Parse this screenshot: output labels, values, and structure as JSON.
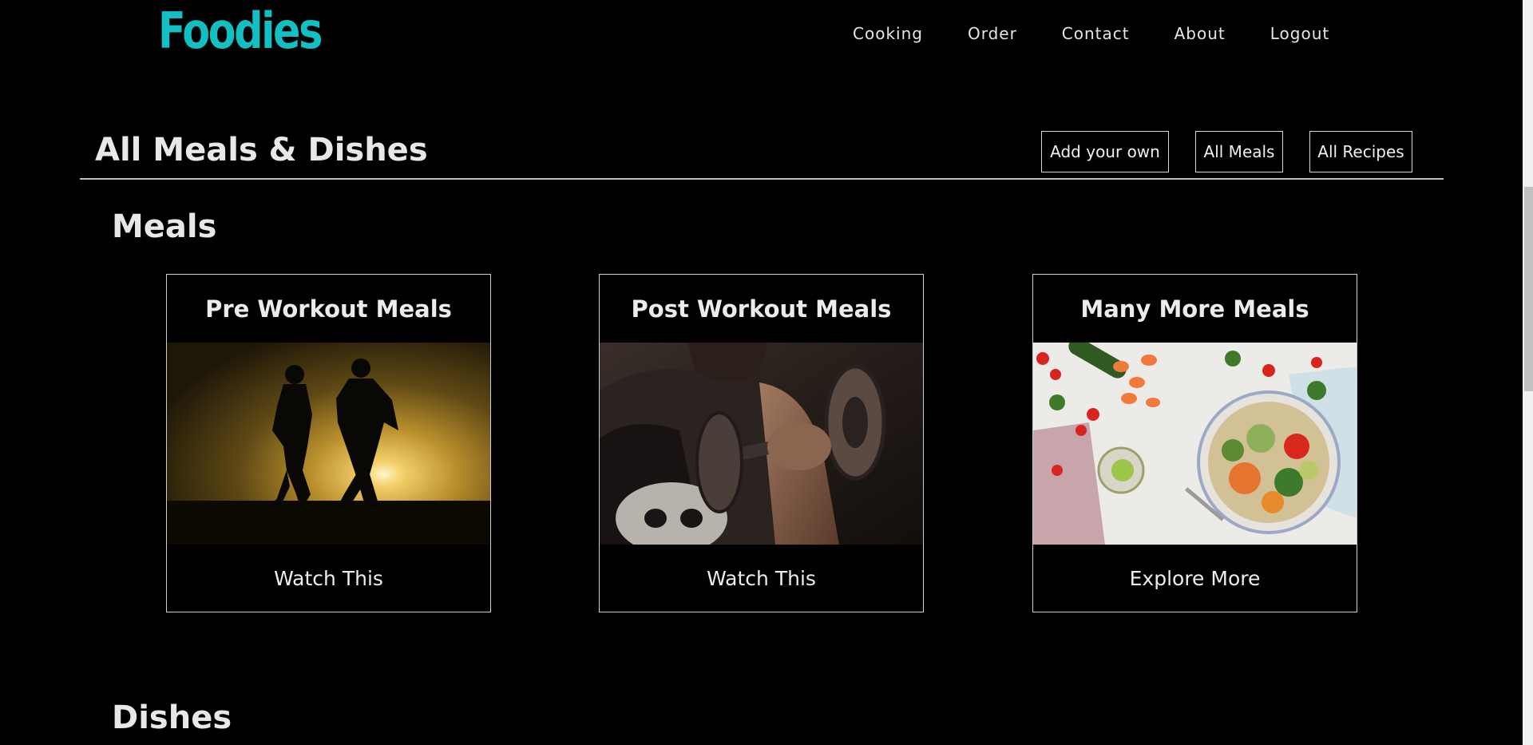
{
  "header": {
    "logo": "Foodies",
    "nav": [
      "Cooking",
      "Order",
      "Contact",
      "About",
      "Logout"
    ]
  },
  "main": {
    "title": "All Meals & Dishes",
    "buttons": [
      "Add your own",
      "All Meals",
      "All Recipes"
    ],
    "meals_heading": "Meals",
    "dishes_heading": "Dishes",
    "cards": [
      {
        "title": "Pre Workout Meals",
        "action": "Watch This",
        "image": "runners-silhouette-sunset"
      },
      {
        "title": "Post Workout Meals",
        "action": "Watch This",
        "image": "man-lifting-dumbbell"
      },
      {
        "title": "Many More Meals",
        "action": "Explore More",
        "image": "healthy-salad-bowl"
      }
    ]
  },
  "colors": {
    "background": "#000000",
    "logo": "#12bfc2",
    "text": "#e8e8e8",
    "border": "#cfcfcf"
  }
}
